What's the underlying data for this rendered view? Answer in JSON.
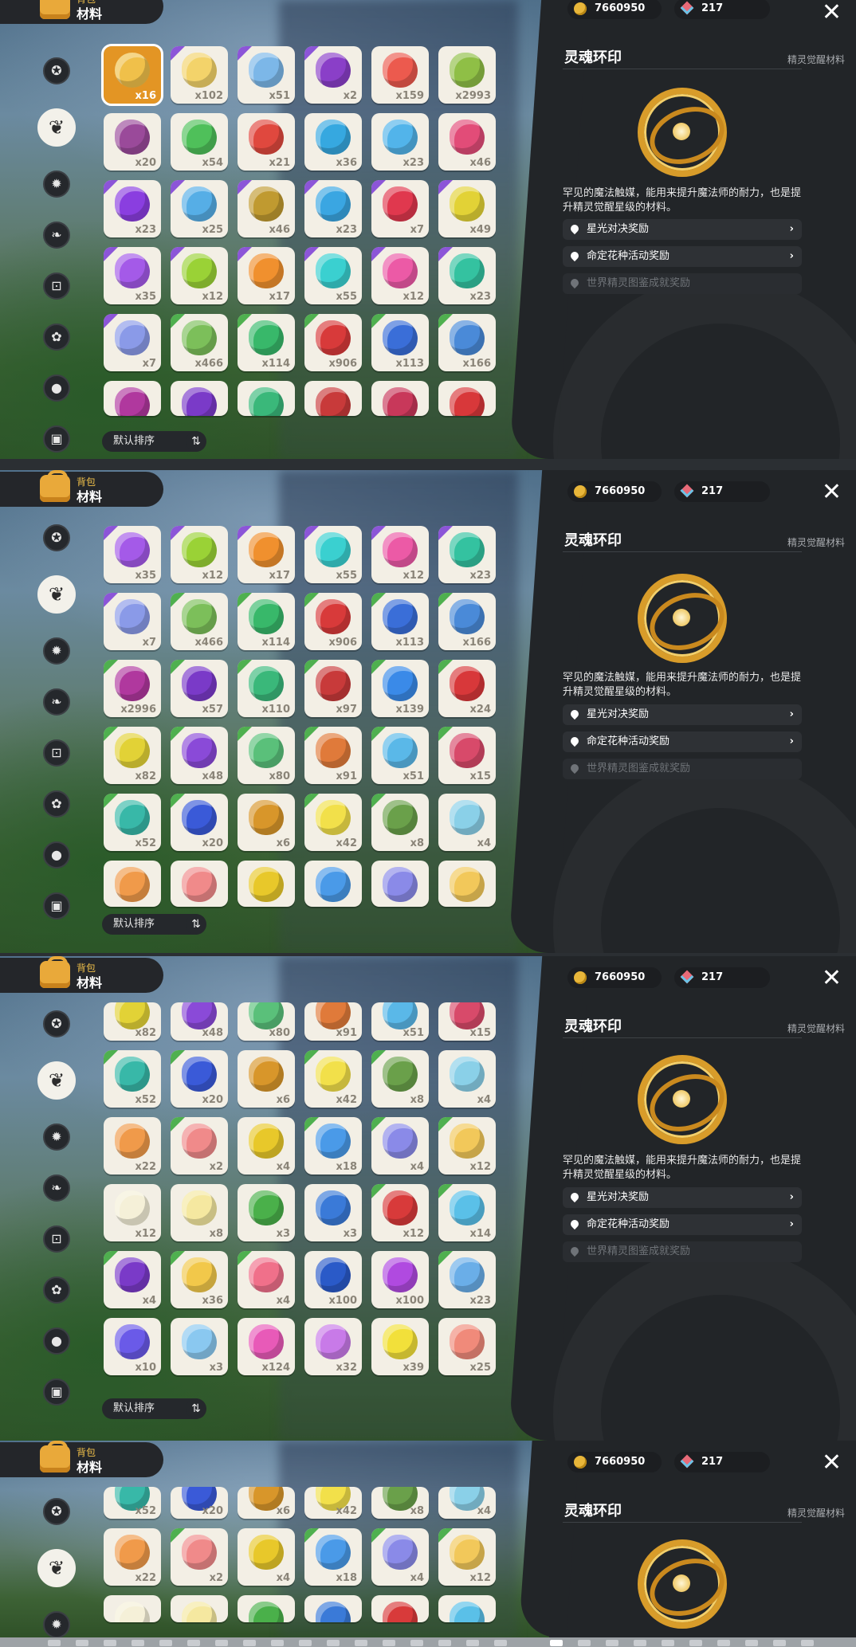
{
  "header": {
    "tab_small": "背包",
    "tab_big": "材料",
    "coins": "7660950",
    "gems": "217"
  },
  "sidebar": {
    "items": [
      {
        "icon": "star-badge-icon"
      },
      {
        "icon": "leaf-icon"
      },
      {
        "icon": "spark-icon"
      },
      {
        "icon": "seedling-icon"
      },
      {
        "icon": "cart-icon"
      },
      {
        "icon": "flower-icon"
      },
      {
        "icon": "acorn-icon"
      },
      {
        "icon": "chest-icon"
      }
    ]
  },
  "sort": {
    "label": "默认排序",
    "toggle": "⇅"
  },
  "detail": {
    "name": "灵魂环印",
    "category": "精灵觉醒材料",
    "description": "罕见的魔法触媒，能用来提升魔法师的耐力，也是提升精灵觉醒星级的材料。",
    "sources": [
      {
        "label": "星光对决奖励",
        "enabled": true
      },
      {
        "label": "命定花种活动奖励",
        "enabled": true
      },
      {
        "label": "世界精灵图鉴成就奖励",
        "enabled": false
      }
    ]
  },
  "colors": {
    "panel": "#222528",
    "accent": "#e39524",
    "rare": "#8c55d8"
  },
  "screens": [
    {
      "rows": [
        [
          "x16",
          "x102",
          "x51",
          "x2",
          "x159",
          "x2993"
        ],
        [
          "x20",
          "x54",
          "x21",
          "x36",
          "x23",
          "x46"
        ],
        [
          "x23",
          "x25",
          "x46",
          "x23",
          "x7",
          "x49"
        ],
        [
          "x35",
          "x12",
          "x17",
          "x55",
          "x12",
          "x23"
        ],
        [
          "x7",
          "x466",
          "x114",
          "x906",
          "x113",
          "x166"
        ],
        [
          "",
          "",
          "",
          "",
          "",
          ""
        ]
      ]
    },
    {
      "rows": [
        [
          "x35",
          "x12",
          "x17",
          "x55",
          "x12",
          "x23"
        ],
        [
          "x7",
          "x466",
          "x114",
          "x906",
          "x113",
          "x166"
        ],
        [
          "x2996",
          "x57",
          "x110",
          "x97",
          "x139",
          "x24"
        ],
        [
          "x82",
          "x48",
          "x80",
          "x91",
          "x51",
          "x15"
        ],
        [
          "x52",
          "x20",
          "x6",
          "x42",
          "x8",
          "x4"
        ],
        [
          "",
          "",
          "",
          "",
          "",
          ""
        ]
      ]
    },
    {
      "rows": [
        [
          "x82",
          "x48",
          "x80",
          "x91",
          "x51",
          "x15"
        ],
        [
          "x52",
          "x20",
          "x6",
          "x42",
          "x8",
          "x4"
        ],
        [
          "x22",
          "x2",
          "x4",
          "x18",
          "x4",
          "x12"
        ],
        [
          "x12",
          "x8",
          "x3",
          "x3",
          "x12",
          "x14"
        ],
        [
          "x4",
          "x36",
          "x4",
          "x100",
          "x100",
          "x23"
        ],
        [
          "x10",
          "x3",
          "x124",
          "x32",
          "x39",
          "x25"
        ]
      ]
    },
    {
      "rows": [
        [
          "x52",
          "x20",
          "x6",
          "x42",
          "x8",
          "x4"
        ],
        [
          "x22",
          "x2",
          "x4",
          "x18",
          "x4",
          "x12"
        ],
        [
          "",
          "",
          "",
          "",
          "",
          ""
        ]
      ]
    }
  ]
}
